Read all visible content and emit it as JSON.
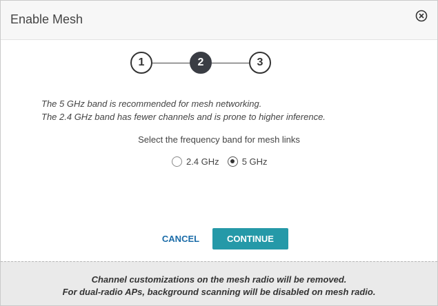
{
  "dialog": {
    "title": "Enable Mesh",
    "close_icon": "close-circle-icon"
  },
  "stepper": {
    "steps": [
      {
        "label": "1",
        "state": "complete"
      },
      {
        "label": "2",
        "state": "active"
      },
      {
        "label": "3",
        "state": "pending"
      }
    ]
  },
  "info": {
    "line1": "The 5 GHz band is recommended for mesh networking.",
    "line2": "The 2.4 GHz band has fewer channels and is prone to higher inference."
  },
  "band": {
    "label": "Select the frequency band for mesh links",
    "options": [
      {
        "label": "2.4 GHz",
        "selected": false
      },
      {
        "label": "5 GHz",
        "selected": true
      }
    ]
  },
  "actions": {
    "cancel_label": "CANCEL",
    "continue_label": "CONTINUE"
  },
  "footer": {
    "line1": "Channel customizations on the mesh radio will be removed.",
    "line2": "For dual-radio APs, background scanning will be disabled on mesh radio."
  },
  "colors": {
    "accent": "#2599a8",
    "link": "#1b6ca8",
    "active_step": "#3a3d44"
  }
}
